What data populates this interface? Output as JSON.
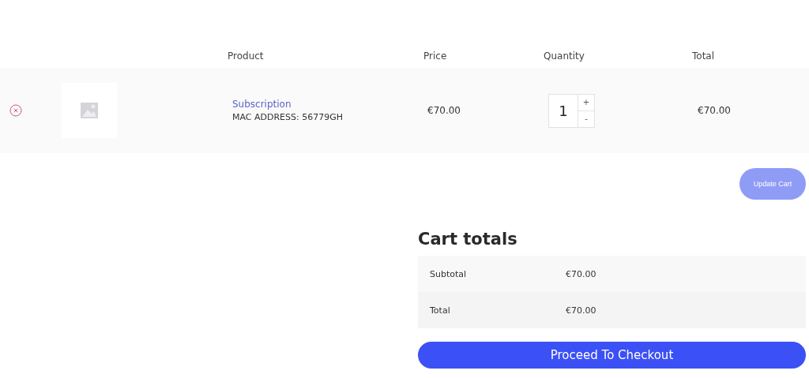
{
  "cart_table": {
    "columns": [
      "Product",
      "Price",
      "Quantity",
      "Total"
    ],
    "rows": [
      {
        "name": "Subscription",
        "meta": "MAC ADDRESS: 56779GH",
        "price": "€70.00",
        "quantity": "1",
        "increment": "+",
        "decrement": "-",
        "total": "€70.00"
      }
    ]
  },
  "update_cart": {
    "label": "Update Cart",
    "disabled": true
  },
  "cart_totals": {
    "title": "Cart totals",
    "rows": [
      {
        "label": "Subtotal",
        "value": "€70.00"
      },
      {
        "label": "Total",
        "value": "€70.00"
      }
    ],
    "checkout": {
      "label": "Proceed To Checkout"
    }
  }
}
